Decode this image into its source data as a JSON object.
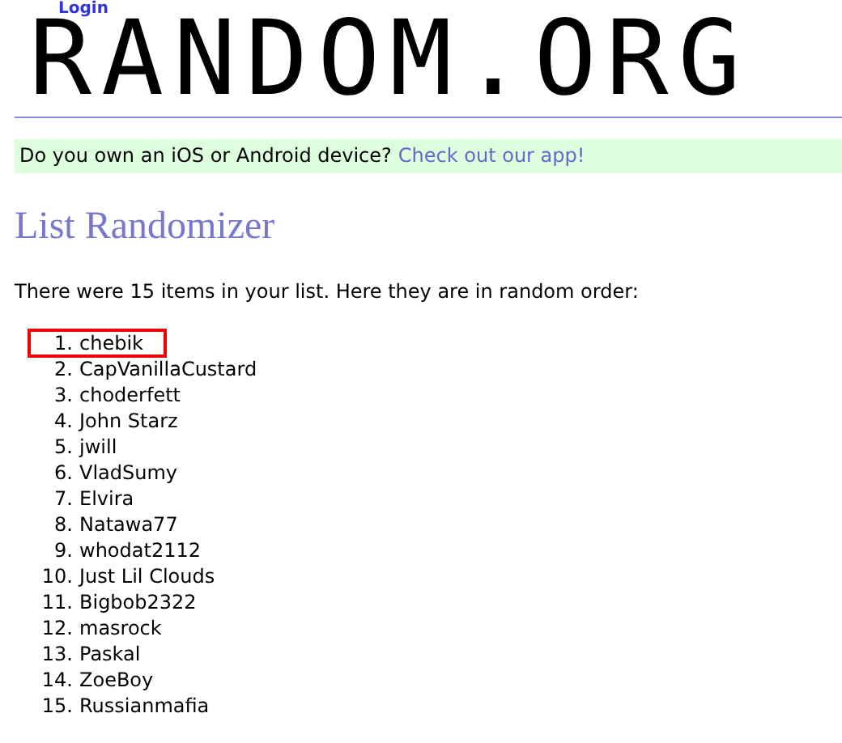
{
  "login_link": "Login",
  "logo": "RANDOM.ORG",
  "banner": {
    "text": "Do you own an iOS or Android device?",
    "link": "Check out our app!"
  },
  "heading": "List Randomizer",
  "intro": "There were 15 items in your list. Here they are in random order:",
  "items": [
    {
      "number": "1.",
      "name": "chebik",
      "highlighted": true
    },
    {
      "number": "2.",
      "name": "CapVanillaCustard",
      "highlighted": false
    },
    {
      "number": "3.",
      "name": "choderfett",
      "highlighted": false
    },
    {
      "number": "4.",
      "name": "John Starz",
      "highlighted": false
    },
    {
      "number": "5.",
      "name": "jwill",
      "highlighted": false
    },
    {
      "number": "6.",
      "name": "VladSumy",
      "highlighted": false
    },
    {
      "number": "7.",
      "name": "Elvira",
      "highlighted": false
    },
    {
      "number": "8.",
      "name": "Natawa77",
      "highlighted": false
    },
    {
      "number": "9.",
      "name": "whodat2112",
      "highlighted": false
    },
    {
      "number": "10.",
      "name": "Just Lil Clouds",
      "highlighted": false
    },
    {
      "number": "11.",
      "name": "Bigbob2322",
      "highlighted": false
    },
    {
      "number": "12.",
      "name": "masrock",
      "highlighted": false
    },
    {
      "number": "13.",
      "name": "Paskal",
      "highlighted": false
    },
    {
      "number": "14.",
      "name": "ZoeBoy",
      "highlighted": false
    },
    {
      "number": "15.",
      "name": "Russianmafia",
      "highlighted": false
    }
  ]
}
